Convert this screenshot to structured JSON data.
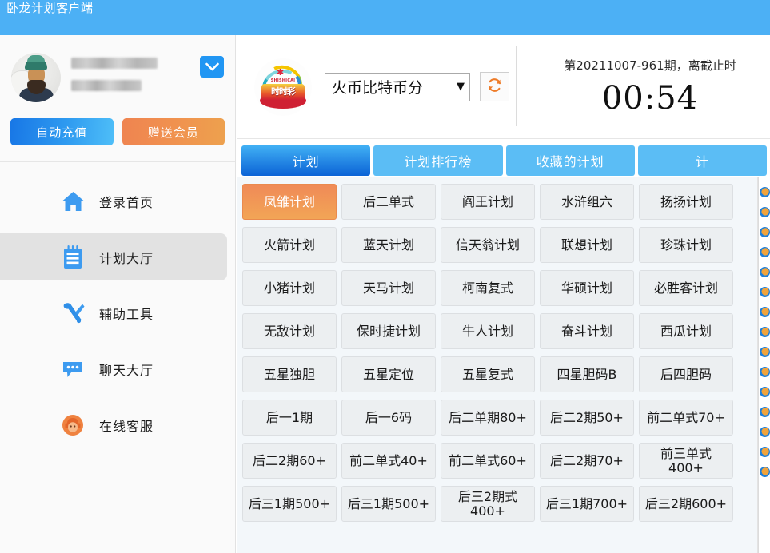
{
  "window": {
    "title": "卧龙计划客户端",
    "titlebar_color": "#4cb0f5"
  },
  "sidebar": {
    "profile": {
      "avatar_name": "user-avatar",
      "username_redacted": "■■■■■■■■■■",
      "expiry_redacted": "■■■■■■■■",
      "expand_icon": "chevron-down-icon"
    },
    "buttons": [
      {
        "label": "自动充值",
        "name": "auto-recharge-button",
        "color": "#2f9bf0"
      },
      {
        "label": "赠送会员",
        "name": "gift-membership-button",
        "color": "#f0934f"
      }
    ],
    "nav": [
      {
        "label": "登录首页",
        "icon": "home-icon",
        "active": false
      },
      {
        "label": "计划大厅",
        "icon": "clipboard-icon",
        "active": true
      },
      {
        "label": "辅助工具",
        "icon": "tools-icon",
        "active": false
      },
      {
        "label": "聊天大厅",
        "icon": "chat-bubble-icon",
        "active": false
      },
      {
        "label": "在线客服",
        "icon": "headset-support-icon",
        "active": false
      }
    ]
  },
  "header": {
    "logo_alt": "时时彩",
    "logo_pinyin": "SHISHICAI",
    "logo_word": "时时彩",
    "lottery_select": {
      "value": "火币比特币分",
      "caret": "▼"
    },
    "refresh_icon": "refresh-icon",
    "refresh_color": "#ee7b28",
    "countdown": {
      "issue": "第20211007-961期，离截止时",
      "time": "00:54"
    }
  },
  "tabs": [
    {
      "label": "计划",
      "active": true
    },
    {
      "label": "计划排行榜",
      "active": false
    },
    {
      "label": "收藏的计划",
      "active": false
    },
    {
      "label": "计",
      "active": false
    }
  ],
  "plans": [
    {
      "label": "凤雏计划",
      "selected": true
    },
    {
      "label": "后二单式",
      "selected": false
    },
    {
      "label": "阎王计划",
      "selected": false
    },
    {
      "label": "水浒组六",
      "selected": false
    },
    {
      "label": "扬扬计划",
      "selected": false
    },
    {
      "label": "火箭计划",
      "selected": false
    },
    {
      "label": "蓝天计划",
      "selected": false
    },
    {
      "label": "信天翁计划",
      "selected": false
    },
    {
      "label": "联想计划",
      "selected": false
    },
    {
      "label": "珍珠计划",
      "selected": false
    },
    {
      "label": "小猪计划",
      "selected": false
    },
    {
      "label": "天马计划",
      "selected": false
    },
    {
      "label": "柯南复式",
      "selected": false
    },
    {
      "label": "华硕计划",
      "selected": false
    },
    {
      "label": "必胜客计划",
      "selected": false
    },
    {
      "label": "无敌计划",
      "selected": false
    },
    {
      "label": "保时捷计划",
      "selected": false
    },
    {
      "label": "牛人计划",
      "selected": false
    },
    {
      "label": "奋斗计划",
      "selected": false
    },
    {
      "label": "西瓜计划",
      "selected": false
    },
    {
      "label": "五星独胆",
      "selected": false
    },
    {
      "label": "五星定位",
      "selected": false
    },
    {
      "label": "五星复式",
      "selected": false
    },
    {
      "label": "四星胆码B",
      "selected": false
    },
    {
      "label": "后四胆码",
      "selected": false
    },
    {
      "label": "后一1期",
      "selected": false
    },
    {
      "label": "后一6码",
      "selected": false
    },
    {
      "label": "后二单期80+",
      "selected": false
    },
    {
      "label": "后二2期50+",
      "selected": false
    },
    {
      "label": "前二单式70+",
      "selected": false
    },
    {
      "label": "后二2期60+",
      "selected": false
    },
    {
      "label": "前二单式40+",
      "selected": false
    },
    {
      "label": "前二单式60+",
      "selected": false
    },
    {
      "label": "后二2期70+",
      "selected": false
    },
    {
      "label": "前三单式\n400+",
      "selected": false
    },
    {
      "label": "后三1期500+",
      "selected": false
    },
    {
      "label": "后三1期500+",
      "selected": false
    },
    {
      "label": "后三2期式\n400+",
      "selected": false
    },
    {
      "label": "后三1期700+",
      "selected": false
    },
    {
      "label": "后三2期600+",
      "selected": false
    }
  ]
}
